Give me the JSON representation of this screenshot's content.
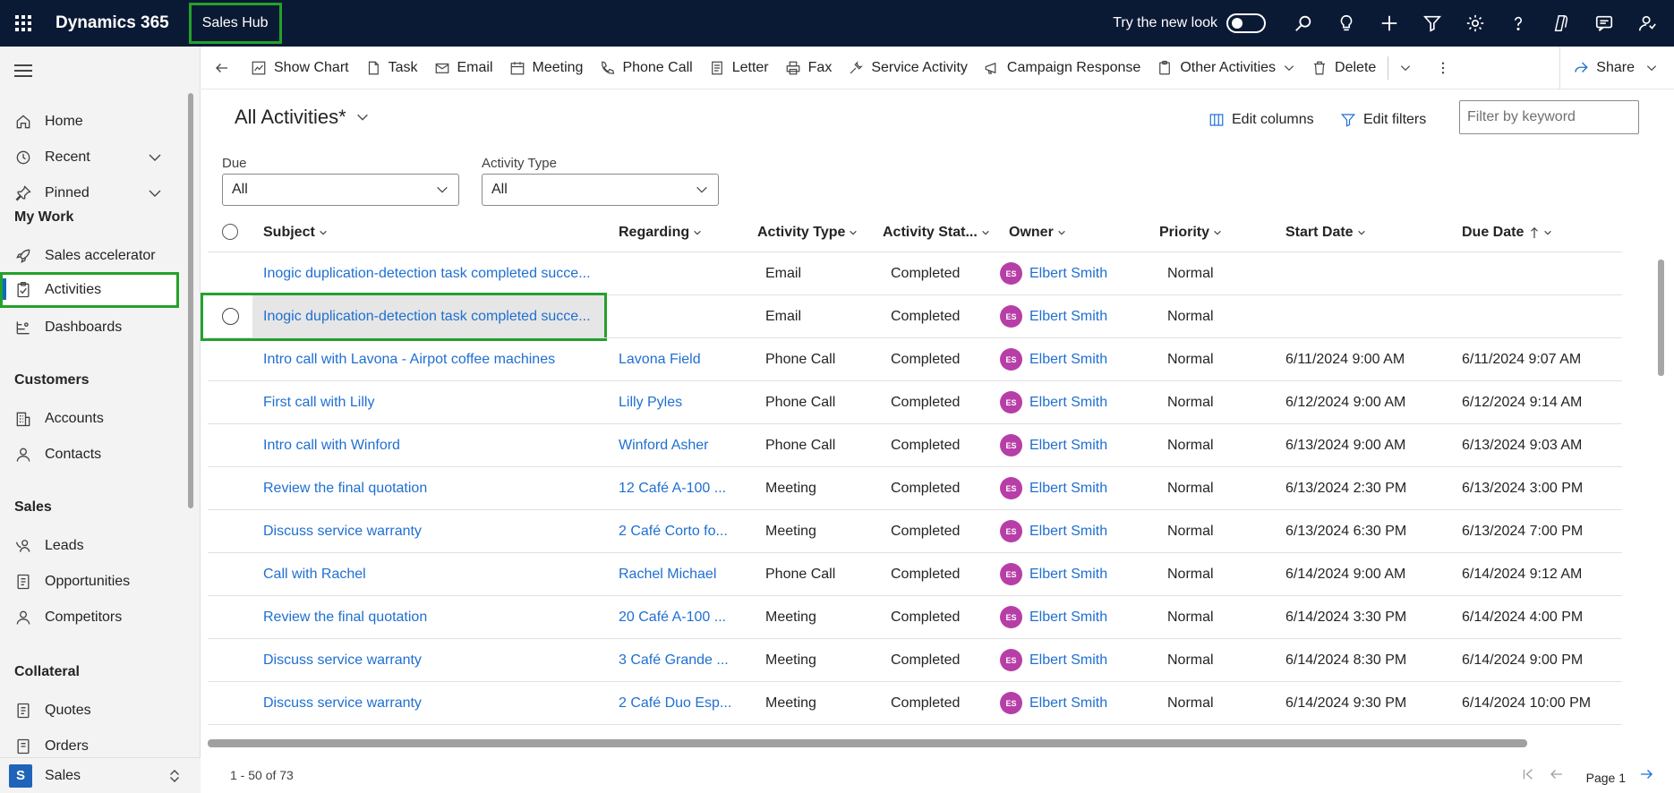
{
  "topbar": {
    "brand": "Dynamics 365",
    "app_name": "Sales Hub",
    "try_new_look": "Try the new look"
  },
  "sidebar": {
    "top_items": [
      {
        "label": "Home",
        "icon": "home-icon"
      },
      {
        "label": "Recent",
        "icon": "clock-icon"
      },
      {
        "label": "Pinned",
        "icon": "pin-icon"
      }
    ],
    "sections": [
      {
        "title": "My Work",
        "items": [
          {
            "label": "Sales accelerator",
            "icon": "rocket-icon"
          },
          {
            "label": "Activities",
            "icon": "clipboard-icon",
            "selected": true
          },
          {
            "label": "Dashboards",
            "icon": "dashboard-icon"
          }
        ]
      },
      {
        "title": "Customers",
        "items": [
          {
            "label": "Accounts",
            "icon": "building-icon"
          },
          {
            "label": "Contacts",
            "icon": "person-icon"
          }
        ]
      },
      {
        "title": "Sales",
        "items": [
          {
            "label": "Leads",
            "icon": "phone-person-icon"
          },
          {
            "label": "Opportunities",
            "icon": "document-icon"
          },
          {
            "label": "Competitors",
            "icon": "person-icon"
          }
        ]
      },
      {
        "title": "Collateral",
        "items": [
          {
            "label": "Quotes",
            "icon": "document-icon"
          },
          {
            "label": "Orders",
            "icon": "document-icon"
          }
        ]
      }
    ],
    "area": {
      "badge": "S",
      "label": "Sales"
    }
  },
  "commands": {
    "show_chart": "Show Chart",
    "task": "Task",
    "email": "Email",
    "meeting": "Meeting",
    "phone_call": "Phone Call",
    "letter": "Letter",
    "fax": "Fax",
    "service_activity": "Service Activity",
    "campaign_response": "Campaign Response",
    "other_activities": "Other Activities",
    "delete": "Delete",
    "share": "Share"
  },
  "view": {
    "title": "All Activities*",
    "edit_columns": "Edit columns",
    "edit_filters": "Edit filters",
    "filter_placeholder": "Filter by keyword",
    "due_label": "Due",
    "due_value": "All",
    "type_label": "Activity Type",
    "type_value": "All"
  },
  "grid": {
    "columns": {
      "subject": "Subject",
      "regarding": "Regarding",
      "activity_type": "Activity Type",
      "activity_status": "Activity Stat...",
      "owner": "Owner",
      "priority": "Priority",
      "start_date": "Start Date",
      "due_date": "Due Date"
    },
    "rows": [
      {
        "subject": "Inogic duplication-detection task completed succe...",
        "regarding": "",
        "type": "Email",
        "status": "Completed",
        "owner_initials": "ES",
        "owner": "Elbert Smith",
        "priority": "Normal",
        "start": "",
        "due": ""
      },
      {
        "subject": "Inogic duplication-detection task completed succe...",
        "regarding": "",
        "type": "Email",
        "status": "Completed",
        "owner_initials": "ES",
        "owner": "Elbert Smith",
        "priority": "Normal",
        "start": "",
        "due": ""
      },
      {
        "subject": "Intro call with Lavona - Airpot coffee machines",
        "regarding": "Lavona Field",
        "type": "Phone Call",
        "status": "Completed",
        "owner_initials": "ES",
        "owner": "Elbert Smith",
        "priority": "Normal",
        "start": "6/11/2024 9:00 AM",
        "due": "6/11/2024 9:07 AM"
      },
      {
        "subject": "First call with Lilly",
        "regarding": "Lilly Pyles",
        "type": "Phone Call",
        "status": "Completed",
        "owner_initials": "ES",
        "owner": "Elbert Smith",
        "priority": "Normal",
        "start": "6/12/2024 9:00 AM",
        "due": "6/12/2024 9:14 AM"
      },
      {
        "subject": "Intro call with Winford",
        "regarding": "Winford Asher",
        "type": "Phone Call",
        "status": "Completed",
        "owner_initials": "ES",
        "owner": "Elbert Smith",
        "priority": "Normal",
        "start": "6/13/2024 9:00 AM",
        "due": "6/13/2024 9:03 AM"
      },
      {
        "subject": "Review the final quotation",
        "regarding": "12 Café A-100 ...",
        "type": "Meeting",
        "status": "Completed",
        "owner_initials": "ES",
        "owner": "Elbert Smith",
        "priority": "Normal",
        "start": "6/13/2024 2:30 PM",
        "due": "6/13/2024 3:00 PM"
      },
      {
        "subject": "Discuss service warranty",
        "regarding": "2 Café Corto fo...",
        "type": "Meeting",
        "status": "Completed",
        "owner_initials": "ES",
        "owner": "Elbert Smith",
        "priority": "Normal",
        "start": "6/13/2024 6:30 PM",
        "due": "6/13/2024 7:00 PM"
      },
      {
        "subject": "Call with Rachel",
        "regarding": "Rachel Michael",
        "type": "Phone Call",
        "status": "Completed",
        "owner_initials": "ES",
        "owner": "Elbert Smith",
        "priority": "Normal",
        "start": "6/14/2024 9:00 AM",
        "due": "6/14/2024 9:12 AM"
      },
      {
        "subject": "Review the final quotation",
        "regarding": "20 Café A-100 ...",
        "type": "Meeting",
        "status": "Completed",
        "owner_initials": "ES",
        "owner": "Elbert Smith",
        "priority": "Normal",
        "start": "6/14/2024 3:30 PM",
        "due": "6/14/2024 4:00 PM"
      },
      {
        "subject": "Discuss service warranty",
        "regarding": "3 Café Grande ...",
        "type": "Meeting",
        "status": "Completed",
        "owner_initials": "ES",
        "owner": "Elbert Smith",
        "priority": "Normal",
        "start": "6/14/2024 8:30 PM",
        "due": "6/14/2024 9:00 PM"
      },
      {
        "subject": "Discuss service warranty",
        "regarding": "2 Café Duo Esp...",
        "type": "Meeting",
        "status": "Completed",
        "owner_initials": "ES",
        "owner": "Elbert Smith",
        "priority": "Normal",
        "start": "6/14/2024 9:30 PM",
        "due": "6/14/2024 10:00 PM"
      }
    ]
  },
  "footer": {
    "record_count": "1 - 50 of 73",
    "page_label": "Page 1"
  },
  "colors": {
    "topbar": "#0b1a34",
    "accent": "#1f6fd1",
    "highlight": "#23a12b",
    "avatar": "#b73ea7"
  }
}
